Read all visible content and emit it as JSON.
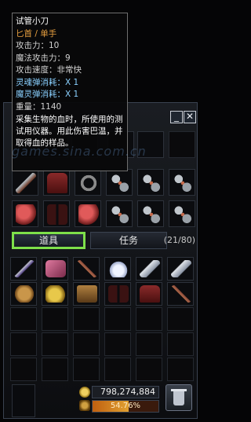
{
  "tooltip": {
    "name": "试管小刀",
    "type": "匕首 / 单手",
    "attack": "攻击力：10",
    "magic_attack": "魔法攻击力：9",
    "attack_speed": "攻击速度：非常快",
    "soul_ammo": "灵魂弹消耗：X 1",
    "spirit_ammo": "魔灵弹消耗：X 1",
    "weight": "重量：1140",
    "description": "采集生物的血时，所使用的测试用仪器。用此伤害巴温，并取得血的样品。"
  },
  "window": {
    "min_label": "_",
    "close_label": "✕"
  },
  "equipment": [
    {
      "icon": "dagger-icon",
      "style": "wpn"
    },
    {
      "icon": "robe-icon",
      "style": "robe"
    },
    {
      "icon": "ring-icon",
      "style": "ring"
    },
    {
      "icon": "necklace-icon",
      "style": "chain"
    },
    {
      "icon": "bracelet-icon",
      "style": "chain"
    },
    {
      "icon": "bracelet-icon",
      "style": "chain"
    },
    {
      "icon": "glove-icon",
      "style": "red"
    },
    {
      "icon": "pants-icon",
      "style": "pants"
    },
    {
      "icon": "boots-icon",
      "style": "red"
    },
    {
      "icon": "ring-icon",
      "style": "chain"
    },
    {
      "icon": "ring-icon",
      "style": "chain"
    },
    {
      "icon": "bracelet-icon",
      "style": "chain"
    }
  ],
  "tabs": {
    "items": "道具",
    "quest": "任务"
  },
  "bag_count": "(21/80)",
  "bag_items": [
    {
      "icon": "wand-icon",
      "style": "rod"
    },
    {
      "icon": "book-icon",
      "style": "pink"
    },
    {
      "icon": "staff-icon",
      "style": "staff"
    },
    {
      "icon": "crystal-icon",
      "style": "crystal"
    },
    {
      "icon": "rune-stone-icon",
      "style": "silverbar"
    },
    {
      "icon": "silver-bar-icon",
      "style": "silverbar"
    },
    {
      "icon": "mask-icon",
      "style": "mask"
    },
    {
      "icon": "gold-ore-icon",
      "style": "gold"
    },
    {
      "icon": "lantern-icon",
      "style": "lantern"
    },
    {
      "icon": "pants-icon",
      "style": "pants"
    },
    {
      "icon": "vest-icon",
      "style": "robe"
    },
    {
      "icon": "mace-icon",
      "style": "staff"
    }
  ],
  "gold": "798,274,884",
  "exp": {
    "percent_label": "54.76%",
    "fraction": 0.5476
  },
  "watermark": "games.sina.com.cn",
  "colors": {
    "selected_tab": "#7ee04a",
    "item_type": "#e8a040",
    "ammo": "#8ad0ff"
  }
}
